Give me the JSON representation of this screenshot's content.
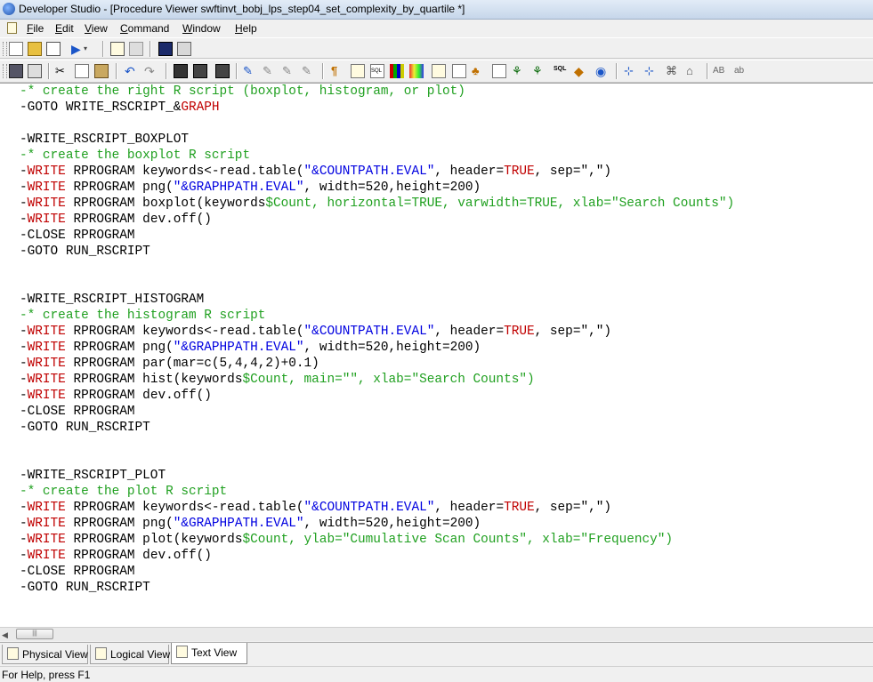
{
  "window": {
    "title": "Developer Studio - [Procedure Viewer swftinvt_bobj_lps_step04_set_complexity_by_quartile *]"
  },
  "menu": {
    "items": [
      {
        "acc": "F",
        "rest": "ile"
      },
      {
        "acc": "E",
        "rest": "dit"
      },
      {
        "acc": "V",
        "rest": "iew"
      },
      {
        "acc": "C",
        "rest": "ommand"
      },
      {
        "acc": "W",
        "rest": "indow"
      },
      {
        "acc": "H",
        "rest": "elp"
      }
    ]
  },
  "toolbar2": {
    "ab_upper": "AB",
    "ab_lower": "ab"
  },
  "colors": {
    "comment": "#20a020",
    "keyword": "#c00000",
    "string": "#0000e0"
  },
  "code": {
    "lines": [
      {
        "segs": [
          {
            "t": "-* create the right R script (boxplot, histogram, or plot)",
            "c": "cmt"
          }
        ]
      },
      {
        "segs": [
          {
            "t": "-GOTO WRITE_RSCRIPT_&",
            "c": ""
          },
          {
            "t": "GRAPH",
            "c": "kw"
          }
        ]
      },
      {
        "segs": [
          {
            "t": "",
            "c": ""
          }
        ]
      },
      {
        "segs": [
          {
            "t": "-WRITE_RSCRIPT_BOXPLOT",
            "c": ""
          }
        ]
      },
      {
        "segs": [
          {
            "t": "-* create the boxplot R script",
            "c": "cmt"
          }
        ]
      },
      {
        "segs": [
          {
            "t": "-",
            "c": ""
          },
          {
            "t": "WRITE",
            "c": "kw"
          },
          {
            "t": " RPROGRAM keywords<-read.table(",
            "c": ""
          },
          {
            "t": "\"&COUNTPATH.EVAL\"",
            "c": "str"
          },
          {
            "t": ", header=",
            "c": ""
          },
          {
            "t": "TRUE",
            "c": "kw"
          },
          {
            "t": ", sep=\",\")",
            "c": ""
          }
        ]
      },
      {
        "segs": [
          {
            "t": "-",
            "c": ""
          },
          {
            "t": "WRITE",
            "c": "kw"
          },
          {
            "t": " RPROGRAM png(",
            "c": ""
          },
          {
            "t": "\"&GRAPHPATH.EVAL\"",
            "c": "str"
          },
          {
            "t": ", width=520,height=200)",
            "c": ""
          }
        ]
      },
      {
        "segs": [
          {
            "t": "-",
            "c": ""
          },
          {
            "t": "WRITE",
            "c": "kw"
          },
          {
            "t": " RPROGRAM boxplot(keywords",
            "c": ""
          },
          {
            "t": "$Count, horizontal=TRUE, varwidth=TRUE, xlab=\"Search Counts\")",
            "c": "par"
          }
        ]
      },
      {
        "segs": [
          {
            "t": "-",
            "c": ""
          },
          {
            "t": "WRITE",
            "c": "kw"
          },
          {
            "t": " RPROGRAM dev.off()",
            "c": ""
          }
        ]
      },
      {
        "segs": [
          {
            "t": "-CLOSE RPROGRAM",
            "c": ""
          }
        ]
      },
      {
        "segs": [
          {
            "t": "-GOTO RUN_RSCRIPT",
            "c": ""
          }
        ]
      },
      {
        "segs": [
          {
            "t": "",
            "c": ""
          }
        ]
      },
      {
        "segs": [
          {
            "t": "",
            "c": ""
          }
        ]
      },
      {
        "segs": [
          {
            "t": "-WRITE_RSCRIPT_HISTOGRAM",
            "c": ""
          }
        ]
      },
      {
        "segs": [
          {
            "t": "-* create the histogram R script",
            "c": "cmt"
          }
        ]
      },
      {
        "segs": [
          {
            "t": "-",
            "c": ""
          },
          {
            "t": "WRITE",
            "c": "kw"
          },
          {
            "t": " RPROGRAM keywords<-read.table(",
            "c": ""
          },
          {
            "t": "\"&COUNTPATH.EVAL\"",
            "c": "str"
          },
          {
            "t": ", header=",
            "c": ""
          },
          {
            "t": "TRUE",
            "c": "kw"
          },
          {
            "t": ", sep=\",\")",
            "c": ""
          }
        ]
      },
      {
        "segs": [
          {
            "t": "-",
            "c": ""
          },
          {
            "t": "WRITE",
            "c": "kw"
          },
          {
            "t": " RPROGRAM png(",
            "c": ""
          },
          {
            "t": "\"&GRAPHPATH.EVAL\"",
            "c": "str"
          },
          {
            "t": ", width=520,height=200)",
            "c": ""
          }
        ]
      },
      {
        "segs": [
          {
            "t": "-",
            "c": ""
          },
          {
            "t": "WRITE",
            "c": "kw"
          },
          {
            "t": " RPROGRAM par(mar=c(5,4,4,2)+0.1)",
            "c": ""
          }
        ]
      },
      {
        "segs": [
          {
            "t": "-",
            "c": ""
          },
          {
            "t": "WRITE",
            "c": "kw"
          },
          {
            "t": " RPROGRAM hist(keywords",
            "c": ""
          },
          {
            "t": "$Count, main=\"\", xlab=\"Search Counts\")",
            "c": "par"
          }
        ]
      },
      {
        "segs": [
          {
            "t": "-",
            "c": ""
          },
          {
            "t": "WRITE",
            "c": "kw"
          },
          {
            "t": " RPROGRAM dev.off()",
            "c": ""
          }
        ]
      },
      {
        "segs": [
          {
            "t": "-CLOSE RPROGRAM",
            "c": ""
          }
        ]
      },
      {
        "segs": [
          {
            "t": "-GOTO RUN_RSCRIPT",
            "c": ""
          }
        ]
      },
      {
        "segs": [
          {
            "t": "",
            "c": ""
          }
        ]
      },
      {
        "segs": [
          {
            "t": "",
            "c": ""
          }
        ]
      },
      {
        "segs": [
          {
            "t": "-WRITE_RSCRIPT_PLOT",
            "c": ""
          }
        ]
      },
      {
        "segs": [
          {
            "t": "-* create the plot R script",
            "c": "cmt"
          }
        ]
      },
      {
        "segs": [
          {
            "t": "-",
            "c": ""
          },
          {
            "t": "WRITE",
            "c": "kw"
          },
          {
            "t": " RPROGRAM keywords<-read.table(",
            "c": ""
          },
          {
            "t": "\"&COUNTPATH.EVAL\"",
            "c": "str"
          },
          {
            "t": ", header=",
            "c": ""
          },
          {
            "t": "TRUE",
            "c": "kw"
          },
          {
            "t": ", sep=\",\")",
            "c": ""
          }
        ]
      },
      {
        "segs": [
          {
            "t": "-",
            "c": ""
          },
          {
            "t": "WRITE",
            "c": "kw"
          },
          {
            "t": " RPROGRAM png(",
            "c": ""
          },
          {
            "t": "\"&GRAPHPATH.EVAL\"",
            "c": "str"
          },
          {
            "t": ", width=520,height=200)",
            "c": ""
          }
        ]
      },
      {
        "segs": [
          {
            "t": "-",
            "c": ""
          },
          {
            "t": "WRITE",
            "c": "kw"
          },
          {
            "t": " RPROGRAM plot(keywords",
            "c": ""
          },
          {
            "t": "$Count, ylab=\"Cumulative Scan Counts\", xlab=\"Frequency\")",
            "c": "par"
          }
        ]
      },
      {
        "segs": [
          {
            "t": "-",
            "c": ""
          },
          {
            "t": "WRITE",
            "c": "kw"
          },
          {
            "t": " RPROGRAM dev.off()",
            "c": ""
          }
        ]
      },
      {
        "segs": [
          {
            "t": "-CLOSE RPROGRAM",
            "c": ""
          }
        ]
      },
      {
        "segs": [
          {
            "t": "-GOTO RUN_RSCRIPT",
            "c": ""
          }
        ]
      }
    ]
  },
  "tabs": [
    {
      "label": "Physical View",
      "active": false
    },
    {
      "label": "Logical View",
      "active": false
    },
    {
      "label": "Text View",
      "active": true
    }
  ],
  "status": {
    "text": "For Help, press F1"
  }
}
